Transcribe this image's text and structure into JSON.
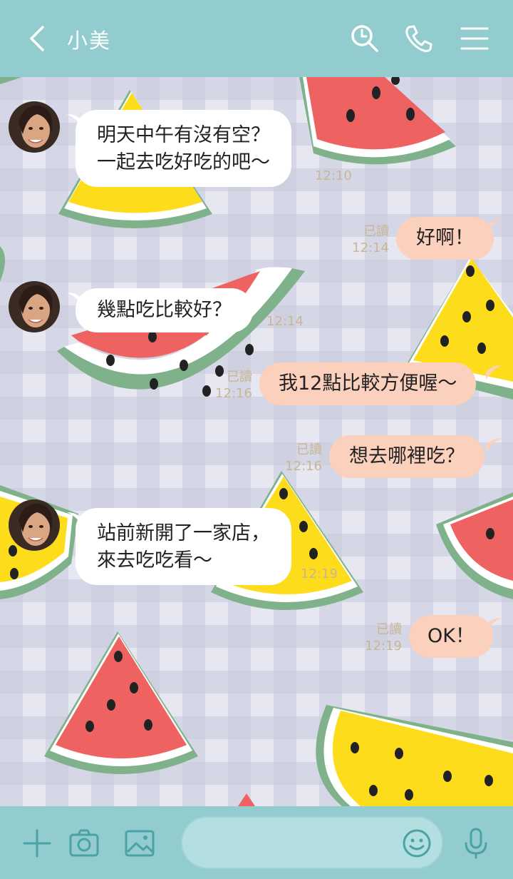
{
  "header": {
    "contact_name": "小美"
  },
  "messages": [
    {
      "side": "in",
      "lines": [
        "明天中午有沒有空？",
        "一起去吃好吃的吧～"
      ],
      "time": "12:10"
    },
    {
      "side": "out",
      "text": "好啊！",
      "read": "已讀",
      "time": "12:14"
    },
    {
      "side": "in",
      "lines": [
        "幾點吃比較好？"
      ],
      "time": "12:14"
    },
    {
      "side": "out",
      "text": "我12點比較方便喔～",
      "read": "已讀",
      "time": "12:16"
    },
    {
      "side": "out",
      "text": "想去哪裡吃？",
      "read": "已讀",
      "time": "12:16"
    },
    {
      "side": "in",
      "lines": [
        "站前新開了一家店，",
        "來去吃吃看～"
      ],
      "time": "12:19"
    },
    {
      "side": "out",
      "text": "OK！",
      "read": "已讀",
      "time": "12:19"
    }
  ],
  "colors": {
    "header": "#93cccf",
    "incoming_bubble": "#ffffff",
    "outgoing_bubble": "#fbd0bd",
    "watermelon_red": "#ef6262",
    "watermelon_yellow": "#fddc1c",
    "rind": "#7fb28a"
  },
  "icons": [
    "back-icon",
    "search-icon",
    "phone-icon",
    "menu-icon",
    "plus-icon",
    "camera-icon",
    "image-icon",
    "emoji-icon",
    "microphone-icon"
  ]
}
